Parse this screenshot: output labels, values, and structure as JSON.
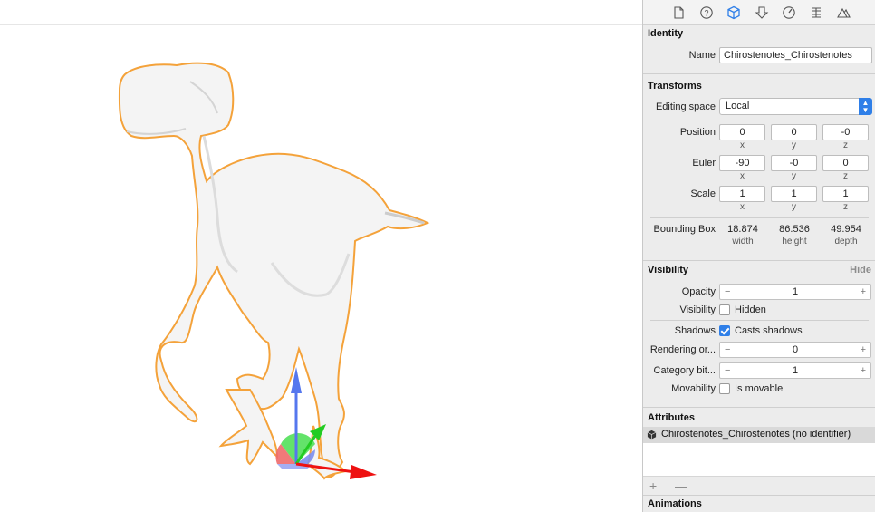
{
  "inspector": {
    "tabs": [
      {
        "icon": "file-icon"
      },
      {
        "icon": "help-icon"
      },
      {
        "icon": "node-cube-icon",
        "selected": true
      },
      {
        "icon": "physics-icon"
      },
      {
        "icon": "speed-icon"
      },
      {
        "icon": "constraints-icon"
      },
      {
        "icon": "material-icon"
      }
    ],
    "identity": {
      "title": "Identity",
      "name_label": "Name",
      "name_value": "Chirostenotes_Chirostenotes"
    },
    "transforms": {
      "title": "Transforms",
      "editing_space_label": "Editing space",
      "editing_space_value": "Local",
      "position": {
        "label": "Position",
        "x": "0",
        "y": "0",
        "z": "-0"
      },
      "euler": {
        "label": "Euler",
        "x": "-90",
        "y": "-0",
        "z": "0"
      },
      "scale": {
        "label": "Scale",
        "x": "1",
        "y": "1",
        "z": "1"
      },
      "axis_labels": {
        "x": "x",
        "y": "y",
        "z": "z"
      },
      "bounding_box": {
        "label": "Bounding Box",
        "width": "18.874",
        "height": "86.536",
        "depth": "49.954",
        "width_label": "width",
        "height_label": "height",
        "depth_label": "depth"
      }
    },
    "visibility": {
      "title": "Visibility",
      "hide_label": "Hide",
      "opacity_label": "Opacity",
      "opacity_value": "1",
      "visibility_label": "Visibility",
      "hidden_label": "Hidden",
      "hidden_checked": false,
      "shadows_label": "Shadows",
      "casts_shadows_label": "Casts shadows",
      "casts_shadows_checked": true,
      "rendering_label": "Rendering or...",
      "rendering_value": "0",
      "category_label": "Category bit...",
      "category_value": "1",
      "movability_label": "Movability",
      "is_movable_label": "Is movable",
      "is_movable_checked": false
    },
    "attributes": {
      "title": "Attributes",
      "item": "Chirostenotes_Chirostenotes (no identifier)",
      "add": "+",
      "remove": "—"
    },
    "animations": {
      "title": "Animations"
    }
  },
  "colors": {
    "selection_outline": "#f4a23a",
    "gizmo_x": "#ee1111",
    "gizmo_y": "#22cc22",
    "gizmo_z": "#5577ee",
    "accent": "#2f7fe8"
  }
}
